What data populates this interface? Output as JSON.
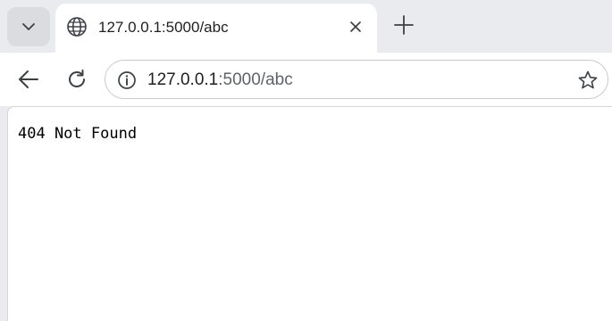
{
  "tabs": [
    {
      "title": "127.0.0.1:5000/abc",
      "icon": "globe-icon"
    }
  ],
  "tab_strip": {
    "menu_icon": "chevron-down-icon",
    "new_tab_icon": "plus-icon",
    "close_icon": "close-icon"
  },
  "toolbar": {
    "back_icon": "arrow-left-icon",
    "reload_icon": "reload-icon",
    "site_info_icon": "info-icon",
    "bookmark_icon": "star-icon"
  },
  "address_bar": {
    "host": "127.0.0.1",
    "rest": ":5000/abc"
  },
  "page": {
    "body_text": "404 Not Found"
  }
}
